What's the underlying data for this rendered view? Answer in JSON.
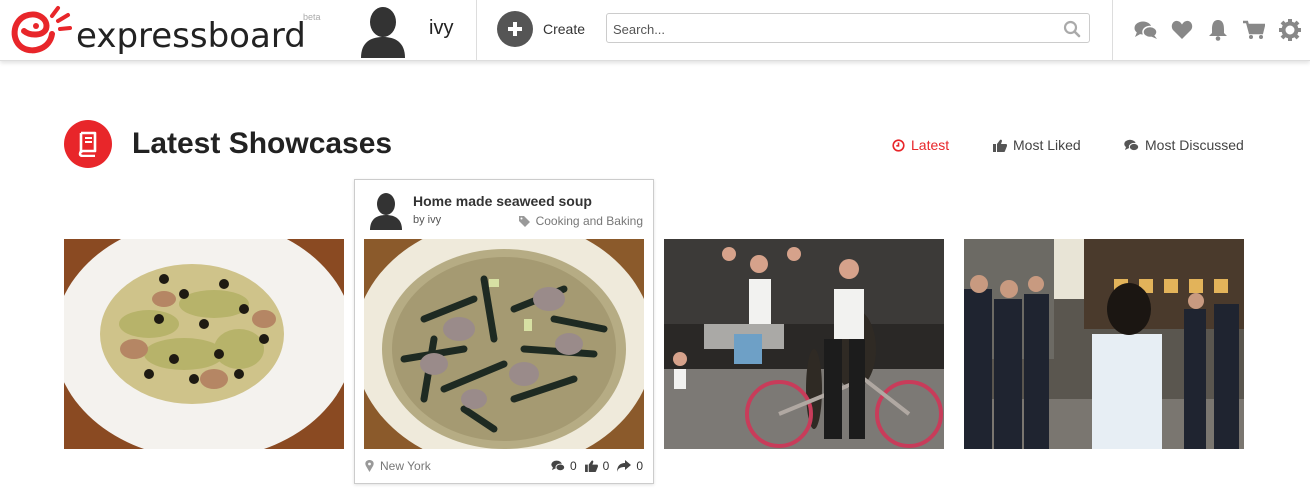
{
  "brand": {
    "name": "expressboard",
    "beta": "beta",
    "accent": "#e8262a"
  },
  "user": {
    "name": "ivy"
  },
  "toolbar": {
    "create_label": "Create"
  },
  "search": {
    "placeholder": "Search...",
    "value": ""
  },
  "header_icons": [
    "chat-icon",
    "heart-icon",
    "bell-icon",
    "cart-icon",
    "gear-icon"
  ],
  "section": {
    "title": "Latest Showcases",
    "filters": [
      {
        "label": "Latest",
        "icon": "clock-icon",
        "active": true
      },
      {
        "label": "Most Liked",
        "icon": "thumbs-up-icon",
        "active": false
      },
      {
        "label": "Most Discussed",
        "icon": "chat-icon",
        "active": false
      }
    ]
  },
  "showcases": [
    {
      "image": "bitter melon stir-fry dish"
    },
    {
      "image": "seaweed soup bowl",
      "title": "Home made seaweed soup",
      "author": "by ivy",
      "category": "Cooking and Baking",
      "location": "New York",
      "comments": "0",
      "likes": "0",
      "shares": "0"
    },
    {
      "image": "street musicians scene"
    },
    {
      "image": "city street crowd"
    }
  ]
}
